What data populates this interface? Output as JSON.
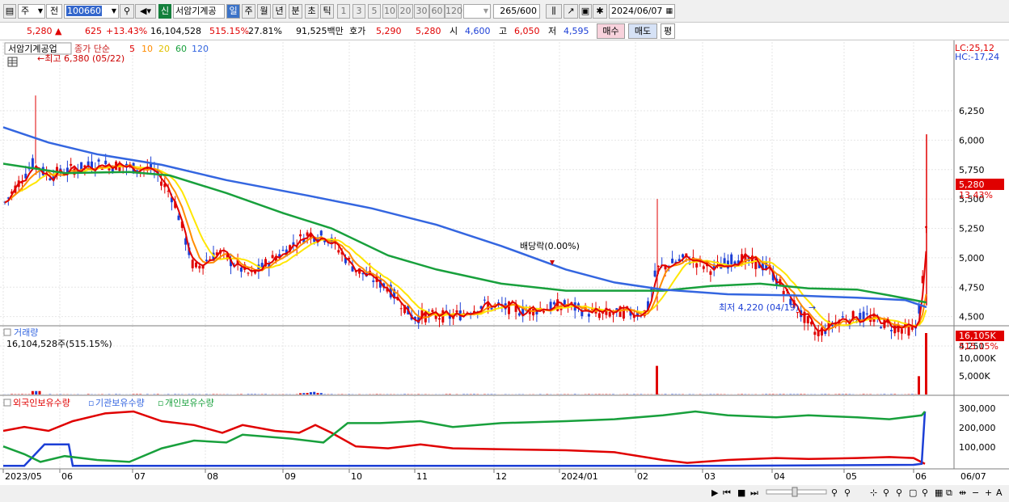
{
  "toolbar": {
    "dropdown1": "주",
    "dropdown2": "전",
    "code": "100660",
    "name": "서암기계공",
    "new_badge": "신",
    "periods": [
      "일",
      "주",
      "월",
      "년",
      "분",
      "초",
      "틱"
    ],
    "intervals": [
      "1",
      "3",
      "5",
      "10",
      "20",
      "30",
      "60",
      "120"
    ],
    "count": "265",
    "count_total": "/600",
    "date": "2024/06/07"
  },
  "quote": {
    "price": "5,280",
    "change": "625",
    "change_pct": "+13.43%",
    "volume": "16,104,528",
    "volume_ratio": "515.15%",
    "turnover": "27.81%",
    "amount": "91,525백만",
    "quote_label": "호가",
    "ask": "5,290",
    "bid": "5,280",
    "open_label": "시",
    "open": "4,600",
    "high_label": "고",
    "high": "6,050",
    "low_label": "저",
    "low": "4,595",
    "buy_label": "매수",
    "sell_label": "매도",
    "avg_label": "평"
  },
  "price_panel": {
    "legend_name": "서암기계공업",
    "legend_type": "종가 단순",
    "ma": [
      "5",
      "10",
      "20",
      "60",
      "120"
    ],
    "high_note": "최고 6,380 (05/22)",
    "low_note": "최저 4,220 (04/19)",
    "dividend_note": "배당락(0.00%)",
    "lc": "LC:25,12",
    "hc": "HC:-17,24",
    "ticks": [
      "6,250",
      "6,000",
      "5,750",
      "5,500",
      "5,250",
      "5,000",
      "4,750",
      "4,500",
      "4,250"
    ],
    "last_price": "5,280",
    "last_pct": "13.43%"
  },
  "volume_panel": {
    "title": "거래량",
    "value": "16,104,528주(515.15%)",
    "ticks": [
      "10,000K",
      "5,000K"
    ],
    "last_value": "16,105K",
    "last_pct": "515.15%"
  },
  "holding_panel": {
    "foreign": "외국인보유수량",
    "institution": "기관보유수량",
    "individual": "개인보유수량",
    "ticks": [
      "300,000",
      "200,000",
      "100,000"
    ]
  },
  "xaxis": {
    "labels": [
      "2023/05",
      "06",
      "07",
      "08",
      "09",
      "10",
      "11",
      "12",
      "2024/01",
      "02",
      "03",
      "04",
      "05",
      "06"
    ],
    "end_label": "06/07"
  },
  "colors": {
    "up": "#e00000",
    "down": "#1c3fd6",
    "ma5": "#e00000",
    "ma10": "#ff8c00",
    "ma20": "#ffe600",
    "ma60": "#18a03c",
    "ma120": "#3466e0"
  }
}
